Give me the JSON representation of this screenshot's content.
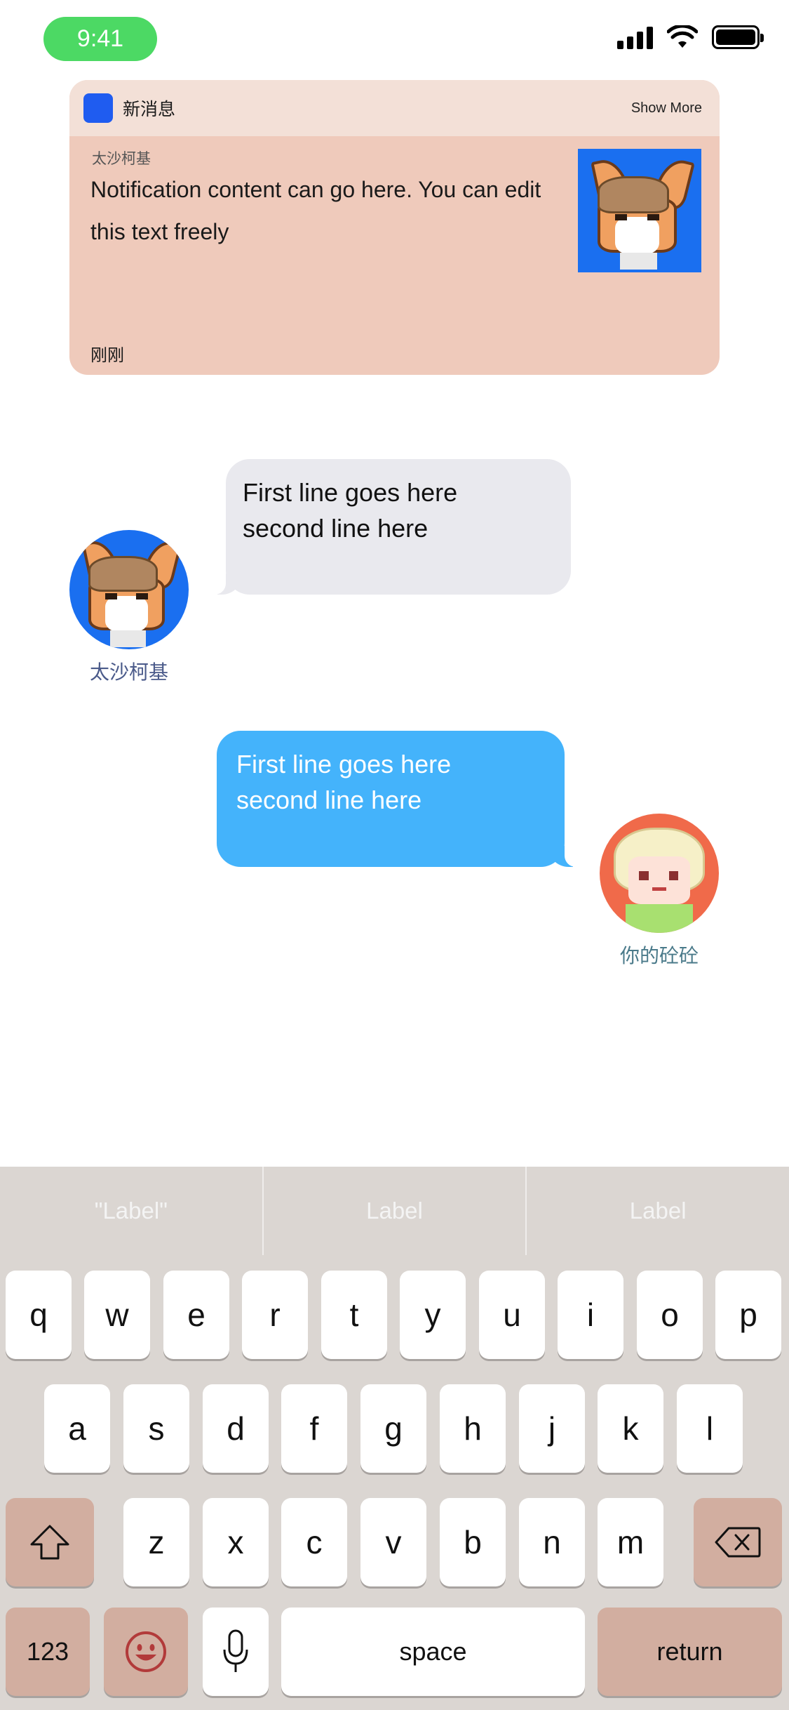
{
  "status_bar": {
    "time": "9:41"
  },
  "notification": {
    "app_name": "新消息",
    "show_more": "Show More",
    "sender": "太沙柯基",
    "body": "Notification content can go here. You can edit this text freely",
    "time": "刚刚"
  },
  "chat": {
    "incoming": {
      "sender": "太沙柯基",
      "line1": "First line goes here",
      "line2": "second line here"
    },
    "outgoing": {
      "sender": "你的砼砼",
      "line1": "First line goes here",
      "line2": "second line here"
    }
  },
  "keyboard": {
    "suggestions": [
      "\"Label\"",
      "Label",
      "Label"
    ],
    "row1": [
      "q",
      "w",
      "e",
      "r",
      "t",
      "y",
      "u",
      "i",
      "o",
      "p"
    ],
    "row2": [
      "a",
      "s",
      "d",
      "f",
      "g",
      "h",
      "j",
      "k",
      "l"
    ],
    "row3": [
      "z",
      "x",
      "c",
      "v",
      "b",
      "n",
      "m"
    ],
    "numbers_label": "123",
    "space_label": "space",
    "return_label": "return",
    "shift_icon": "shift-arrow-icon",
    "delete_icon": "backspace-icon",
    "emoji_icon": "smiley-face-icon",
    "mic_icon": "microphone-icon",
    "func_key_color": "#d2aea0"
  },
  "colors": {
    "outgoing_bubble": "#44b3fb",
    "incoming_bubble": "#e9e9ee",
    "notification_bg": "#efcabb",
    "status_time_pill": "#4cd964"
  }
}
